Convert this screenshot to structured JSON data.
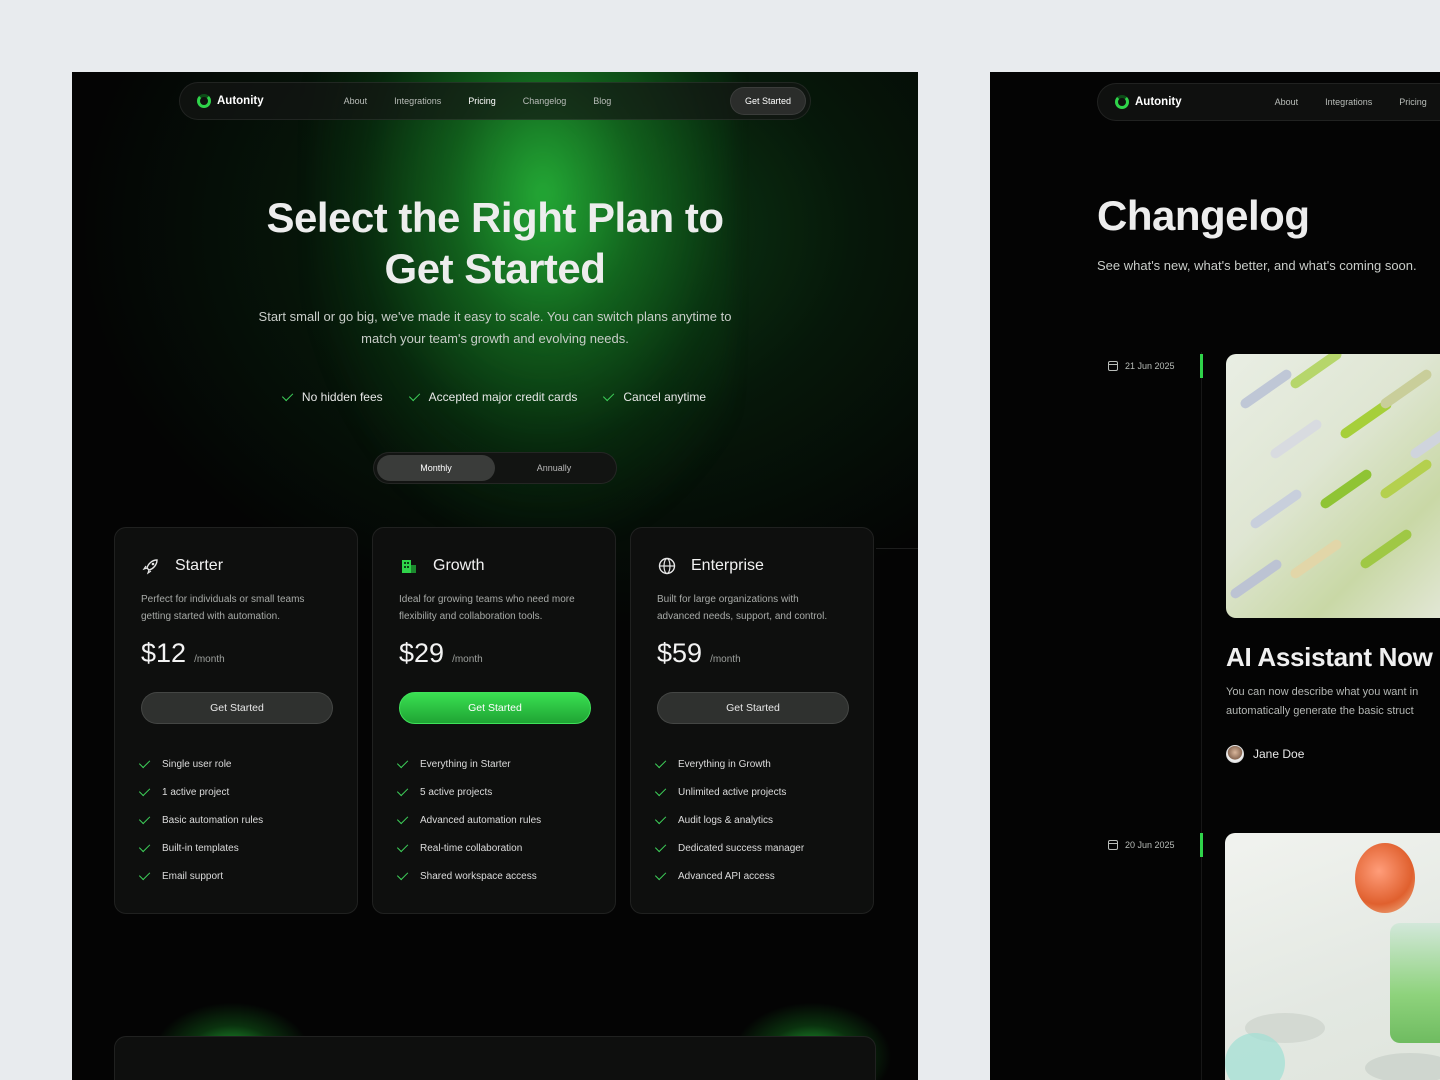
{
  "brand": {
    "name": "Autonity",
    "accent": "#2fd34a"
  },
  "nav": {
    "links": [
      "About",
      "Integrations",
      "Pricing",
      "Changelog",
      "Blog"
    ],
    "active": "Pricing",
    "cta": "Get Started"
  },
  "hero": {
    "title_line1": "Select the Right Plan to",
    "title_line2": "Get Started",
    "subtitle_line1": "Start small or go big, we've made it easy to scale. You can switch plans anytime to",
    "subtitle_line2": "match your team's growth and evolving needs.",
    "features": [
      "No hidden fees",
      "Accepted major credit cards",
      "Cancel anytime"
    ]
  },
  "billing_toggle": {
    "options": [
      "Monthly",
      "Annually"
    ],
    "selected": "Monthly"
  },
  "plans": [
    {
      "name": "Starter",
      "icon": "rocket-icon",
      "desc_line1": "Perfect for individuals or small teams",
      "desc_line2": "getting started with automation.",
      "price": "$12",
      "period": "/month",
      "cta": "Get Started",
      "highlight": false,
      "features": [
        "Single user role",
        "1 active project",
        "Basic automation rules",
        "Built-in templates",
        "Email support"
      ]
    },
    {
      "name": "Growth",
      "icon": "building-icon",
      "desc_line1": "Ideal for growing teams who need more",
      "desc_line2": "flexibility and collaboration tools.",
      "price": "$29",
      "period": "/month",
      "cta": "Get Started",
      "highlight": true,
      "features": [
        "Everything in Starter",
        "5 active projects",
        "Advanced automation rules",
        "Real-time collaboration",
        "Shared workspace access"
      ]
    },
    {
      "name": "Enterprise",
      "icon": "globe-icon",
      "desc_line1": "Built for large organizations with",
      "desc_line2": "advanced needs, support, and control.",
      "price": "$59",
      "period": "/month",
      "cta": "Get Started",
      "highlight": false,
      "features": [
        "Everything in Growth",
        "Unlimited active projects",
        "Audit logs & analytics",
        "Dedicated success manager",
        "Advanced API access"
      ]
    }
  ],
  "changelog": {
    "nav_links": [
      "About",
      "Integrations",
      "Pricing"
    ],
    "title": "Changelog",
    "subtitle": "See what's new, what's better, and what's coming soon.",
    "entries": [
      {
        "date": "21 Jun 2025",
        "title": "AI Assistant Now I",
        "body_line1": "You can now describe what you want in",
        "body_line2": "automatically generate the basic struct",
        "author": "Jane Doe"
      },
      {
        "date": "20 Jun 2025"
      }
    ]
  }
}
